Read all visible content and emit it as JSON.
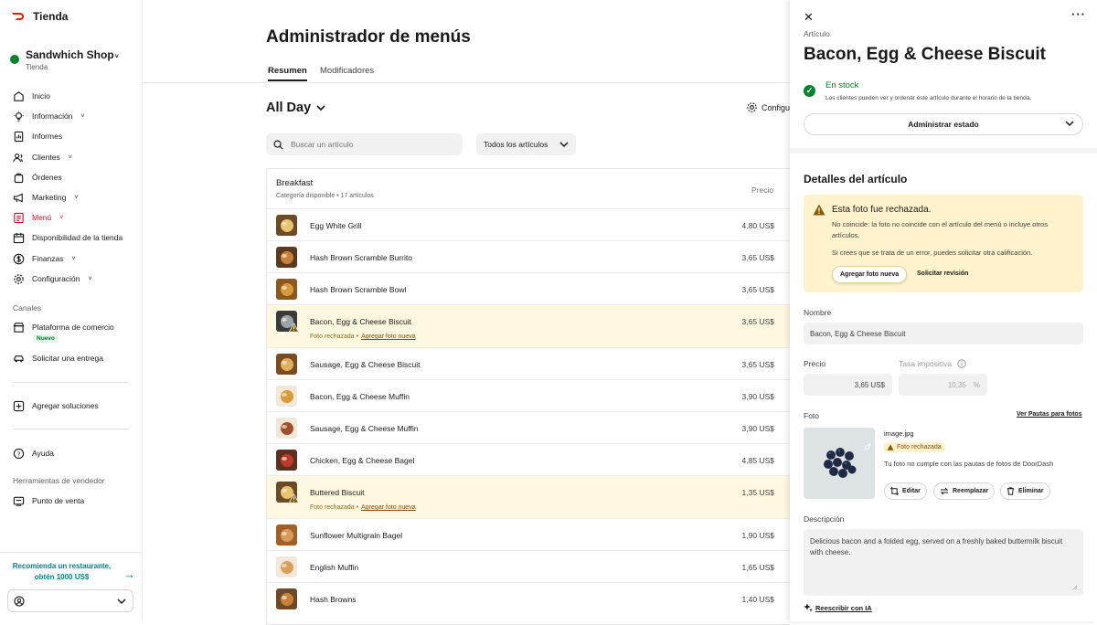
{
  "brand": {
    "name": "Tienda",
    "color": "#eb1700"
  },
  "store": {
    "name": "Sandwhich Shop",
    "subtitle": "Tienda",
    "status_color": "#00832d"
  },
  "nav": {
    "items": [
      {
        "label": "Inicio",
        "icon": "home-icon"
      },
      {
        "label": "Información",
        "icon": "lightbulb-icon"
      },
      {
        "label": "Informes",
        "icon": "report-icon"
      },
      {
        "label": "Clientes",
        "icon": "users-icon"
      },
      {
        "label": "Órdenes",
        "icon": "bag-icon"
      },
      {
        "label": "Marketing",
        "icon": "megaphone-icon"
      },
      {
        "label": "Menú",
        "icon": "menu-book-icon"
      },
      {
        "label": "Disponibilidad de la tienda",
        "icon": "calendar-icon"
      },
      {
        "label": "Finanzas",
        "icon": "dollar-icon"
      },
      {
        "label": "Configuración",
        "icon": "gear-icon"
      }
    ],
    "channels_label": "Canales",
    "commerce_platform": "Plataforma de comercio",
    "new_badge": "Nuevo",
    "request_delivery": "Solicitar una entrega",
    "add_solutions": "Agregar soluciones",
    "help": "Ayuda",
    "seller_tools_label": "Herramientas de vendedor",
    "pos": "Punto de venta",
    "referral": "Recomienda un restaurante, obtén 1000 US$"
  },
  "main": {
    "title": "Administrador de menús",
    "tabs": [
      "Resumen",
      "Modificadores"
    ],
    "menu_name": "All Day",
    "config_label": "Configu",
    "search_placeholder": "Buscar un artículo",
    "filter_value": "Todos los artículos",
    "category": {
      "name": "Breakfast",
      "subtitle": "Categoría disponible • 17 artículos",
      "price_header": "Precio"
    },
    "rejected_label": "Foto rechazada",
    "add_photo_link": "Agregar foto nueva",
    "items": [
      {
        "name": "Egg White Grill",
        "price": "4,80 US$",
        "rejected": false
      },
      {
        "name": "Hash Brown Scramble Burrito",
        "price": "3,65 US$",
        "rejected": false
      },
      {
        "name": "Hash Brown Scramble Bowl",
        "price": "3,65 US$",
        "rejected": false
      },
      {
        "name": "Bacon, Egg & Cheese Biscuit",
        "price": "3,65 US$",
        "rejected": true
      },
      {
        "name": "Sausage, Egg & Cheese Biscuit",
        "price": "3,65 US$",
        "rejected": false
      },
      {
        "name": "Bacon, Egg & Cheese Muffin",
        "price": "3,90 US$",
        "rejected": false
      },
      {
        "name": "Sausage, Egg & Cheese Muffin",
        "price": "3,90 US$",
        "rejected": false
      },
      {
        "name": "Chicken, Egg & Cheese Bagel",
        "price": "4,85 US$",
        "rejected": false
      },
      {
        "name": "Buttered Biscuit",
        "price": "1,35 US$",
        "rejected": true
      },
      {
        "name": "Sunflower Multigrain Bagel",
        "price": "1,90 US$",
        "rejected": false
      },
      {
        "name": "English Muffin",
        "price": "1,65 US$",
        "rejected": false
      },
      {
        "name": "Hash Browns",
        "price": "1,40 US$",
        "rejected": false
      }
    ]
  },
  "panel": {
    "kicker": "Artículo",
    "title": "Bacon, Egg & Cheese Biscuit",
    "stock_title": "En stock",
    "stock_desc": "Los clientes pueden ver y ordenar este artículo durante el horario de la tienda.",
    "manage_button": "Administrar estado",
    "details_heading": "Detalles del artículo",
    "alert_title": "Esta foto fue rechazada.",
    "alert_body": "No coincide: la foto no coincide con el artículo del menú o incluye otros artículos.",
    "alert_body2": "Si crees que se trata de un error, puedes solicitar otra calificación.",
    "alert_button": "Agregar foto nueva",
    "alert_link": "Solicitar revisión",
    "name_label": "Nombre",
    "name_value": "Bacon, Egg & Cheese Biscuit",
    "price_label": "Precio",
    "price_value": "3,65 US$",
    "tax_label": "Tasa impositiva",
    "tax_value": "10,35",
    "tax_unit": "%",
    "photo_label": "Foto",
    "photo_guide_link": "Ver Pautas para fotos",
    "photo_file": "image.jpg",
    "photo_badge": "Foto rechazada",
    "photo_note": "Tu foto no cumple con las pautas de fotos de DoorDash",
    "edit_button": "Editar",
    "replace_button": "Reemplazar",
    "delete_button": "Eliminar",
    "desc_label": "Descripción",
    "desc_value": "Delicious bacon and a folded egg, served on a freshly baked buttermilk biscuit with cheese.",
    "ai_link": "Reescribir con IA"
  }
}
